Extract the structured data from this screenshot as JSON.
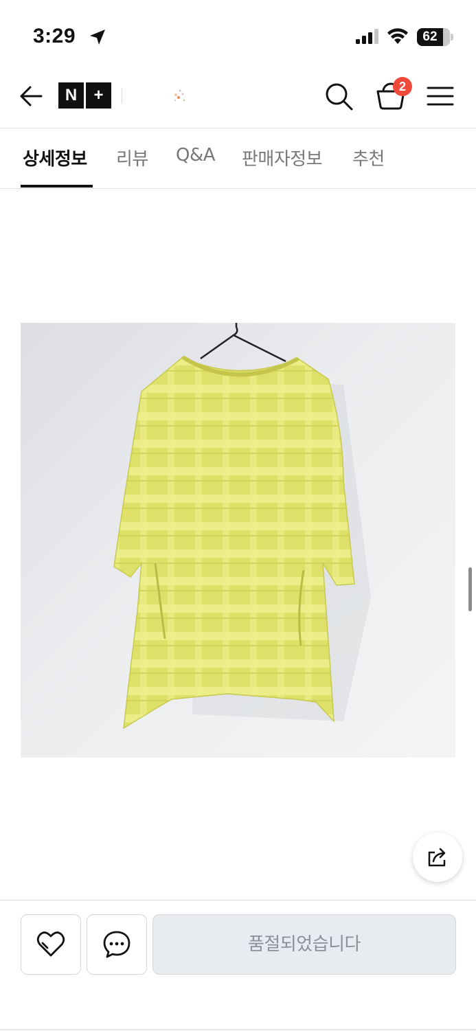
{
  "status_bar": {
    "time": "3:29",
    "battery": "62",
    "icons": [
      "location-arrow-icon",
      "cellular-signal-icon",
      "wifi-icon",
      "battery-icon"
    ]
  },
  "header": {
    "logo_left": "N",
    "logo_right": "+",
    "icons": [
      "back-arrow-icon",
      "search-icon",
      "cart-icon",
      "menu-icon"
    ],
    "cart_count": "2"
  },
  "tabs": [
    {
      "label": "상세정보",
      "active": true
    },
    {
      "label": "리뷰"
    },
    {
      "label": "Q&A"
    },
    {
      "label": "판매자정보"
    },
    {
      "label": "추천"
    }
  ],
  "product": {
    "image": "yellow-checked-tunic-photo"
  },
  "bottom_bar": {
    "soldout_label": "품절되었습니다",
    "icons": [
      "heart-icon",
      "chat-icon",
      "share-icon"
    ]
  },
  "colors": {
    "accent": "#111111",
    "badge": "#f04b3a",
    "disabled_bg": "#e8ebef",
    "disabled_text": "#8c8f95"
  }
}
